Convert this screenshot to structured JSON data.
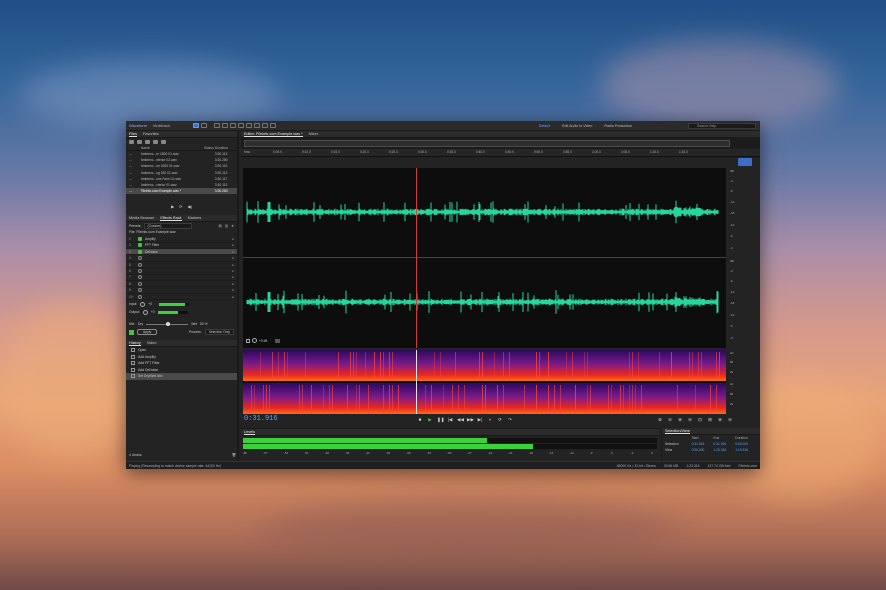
{
  "topbar": {
    "modes": [
      "Waveform",
      "Multitrack"
    ],
    "workspaces": [
      "Default",
      "Edit Audio to Video",
      "Radio Production"
    ],
    "search_placeholder": "Search Help"
  },
  "files_panel": {
    "tabs": [
      "Files",
      "Favorites"
    ],
    "columns": [
      "Name",
      "Status",
      "Duration"
    ],
    "files": [
      {
        "name": "Ambienc...er 1800 01.wav",
        "duration": "3:30.113"
      },
      {
        "name": "Ambienc...nterior 02.wav",
        "duration": "3:30.280"
      },
      {
        "name": "Ambienc...ior 1800 01.wav",
        "duration": "3:30.113"
      },
      {
        "name": "Ambienc...ug 180 01.wav",
        "duration": "3:30.113"
      },
      {
        "name": "Ambienc...ons Fans 01.wav",
        "duration": "3:30.117"
      },
      {
        "name": "Ambienc...xterior 01.wav",
        "duration": "3:30.113"
      },
      {
        "name": "Filelnfo.com Example.wav *",
        "duration": "3:30.283"
      }
    ]
  },
  "effects_panel": {
    "tabs": [
      "Media Browser",
      "Effects Rack",
      "Markers"
    ],
    "presets_label": "Presets:",
    "preset_value": "(Custom)",
    "file_label": "File: Filelnfo.com Example.wav",
    "slots": [
      {
        "num": "1",
        "name": "Amplify",
        "on": true
      },
      {
        "num": "2",
        "name": "FFT Filter",
        "on": true
      },
      {
        "num": "3",
        "name": "DeNoise",
        "on": true
      },
      {
        "num": "4",
        "name": "",
        "on": false
      },
      {
        "num": "5",
        "name": "",
        "on": false
      },
      {
        "num": "6",
        "name": "",
        "on": false
      },
      {
        "num": "7",
        "name": "",
        "on": false
      },
      {
        "num": "8",
        "name": "",
        "on": false
      },
      {
        "num": "9",
        "name": "",
        "on": false
      },
      {
        "num": "10",
        "name": "",
        "on": false
      }
    ],
    "input_label": "Input:",
    "output_label": "Output:",
    "input_value": "+0",
    "output_value": "+0",
    "input_level": 0.85,
    "output_level": 0.68,
    "mix_label": "Mix:",
    "dry_label": "Dry",
    "wet_label": "Wet",
    "mix_value": "50 %",
    "apply_label": "Apply",
    "process_label": "Process:",
    "process_value": "Selection Only"
  },
  "history_panel": {
    "tabs": [
      "History",
      "Video"
    ],
    "items": [
      "Open",
      "Add Amplify",
      "Add FFT Filter",
      "Add DeNoise",
      "Set Dry/Wet Mix"
    ],
    "undo_count": "4 Undos"
  },
  "editor": {
    "tabs": [
      "Editor: Filelnfo.com Example.wav *",
      "Mixer"
    ],
    "ruler_labels": [
      "hms",
      "0:05.0",
      "0:10.0",
      "0:15.0",
      "0:20.0",
      "0:25.0",
      "0:30.0",
      "0:35.0",
      "0:40.0",
      "0:45.0",
      "0:50.0",
      "0:55.0",
      "1:00.0",
      "1:05.0",
      "1:10.0",
      "1:15.0"
    ],
    "db_scale_top": [
      "dB",
      "-3",
      "-6",
      "-12",
      "-18",
      "-12",
      "-6",
      "-3"
    ],
    "db_scale_bottom": [
      "dB",
      "-3",
      "-6",
      "-12",
      "-18",
      "-12",
      "-6",
      "-3"
    ],
    "gain_value": "+0 dB",
    "spec_scale": [
      "Hz",
      "8k",
      "2k",
      "Hz",
      "8k",
      "2k"
    ],
    "current_time": "0:31.916"
  },
  "levels_panel": {
    "title": "Levels",
    "scale": [
      "dB",
      "-57",
      "-54",
      "-51",
      "-48",
      "-45",
      "-42",
      "-39",
      "-36",
      "-33",
      "-30",
      "-27",
      "-24",
      "-21",
      "-18",
      "-15",
      "-12",
      "-9",
      "-6",
      "-3",
      "0"
    ],
    "left_level": 0.59,
    "right_level": 0.7
  },
  "selection_panel": {
    "title": "Selection/View",
    "columns": [
      "Start",
      "End",
      "Duration"
    ],
    "rows": [
      {
        "label": "Selection",
        "start": "0:31.916",
        "end": "0:31.916",
        "duration": "0:00.000"
      },
      {
        "label": "View",
        "start": "0:00.000",
        "end": "1:19.316",
        "duration": "1:19.316"
      }
    ]
  },
  "statusbar": {
    "message": "Playing (Resampling to match device sample rate: 44100 Hz)",
    "info": [
      "48000 Hz • 32-bit • Stereo",
      "30.56 MB",
      "1:23.316",
      "137.74 GB free"
    ],
    "brand": "FileInfo.com"
  }
}
